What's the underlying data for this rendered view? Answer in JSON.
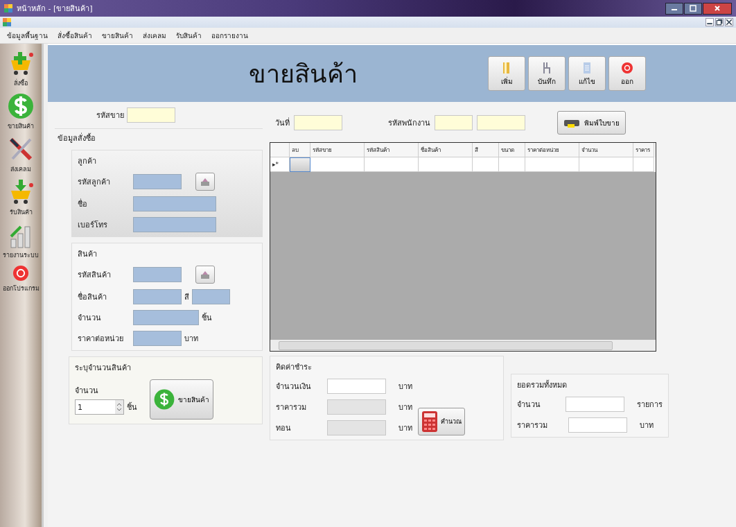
{
  "window": {
    "title": "หน้าหลัก - [ขายสินค้า]"
  },
  "menu": [
    "ข้อมูลพื้นฐาน",
    "สั่งซื้อสินค้า",
    "ขายสินค้า",
    "ส่งเคลม",
    "รับสินค้า",
    "ออกรายงาน"
  ],
  "sidebar": {
    "items": [
      {
        "label": "สั่งซื้อ",
        "kind": "cart-plus"
      },
      {
        "label": "ขายสินค้า",
        "kind": "dollar"
      },
      {
        "label": "ส่งเคลม",
        "kind": "tools"
      },
      {
        "label": "รับสินค้า",
        "kind": "cart-in"
      },
      {
        "label": "รายงานระบบ",
        "kind": "chart"
      },
      {
        "label": "ออกโปรแกรม",
        "kind": "power"
      }
    ]
  },
  "header": {
    "title": "ขายสินค้า",
    "buttons": [
      {
        "label": "เพิ่ม",
        "kind": "add"
      },
      {
        "label": "บันทึก",
        "kind": "save"
      },
      {
        "label": "แก้ไข",
        "kind": "edit"
      },
      {
        "label": "ออก",
        "kind": "exit"
      }
    ]
  },
  "sale_id": {
    "label": "รหัสขาย"
  },
  "order_info": {
    "title": "ข้อมูลสั่งซื้อ",
    "customer": {
      "title": "ลูกค้า",
      "id_label": "รหัสลูกค้า",
      "name_label": "ชื่อ",
      "phone_label": "เบอร์โทร"
    },
    "product": {
      "title": "สินค้า",
      "id_label": "รหัสสินค้า",
      "name_label": "ชื่อสินค้า",
      "color_label": "สี",
      "qty_label": "จำนวน",
      "qty_unit": "ชิ้น",
      "price_label": "ราคาต่อหน่วย",
      "price_unit": "บาท"
    }
  },
  "quantity_box": {
    "title": "ระบุจำนวนสินค้า",
    "label": "จำนวน",
    "value": "1",
    "unit": "ชิ้น",
    "button": "ขายสินค้า"
  },
  "date": {
    "label": "วันที่"
  },
  "employee": {
    "label": "รหัสพนักงาน"
  },
  "print_button": "พิมพ์ใบขาย",
  "table": {
    "columns": [
      "ลบ",
      "รหัสขาย",
      "รหัสสินค้า",
      "ชื่อสินค้า",
      "สี",
      "ขนาด",
      "ราคาต่อหน่วย",
      "จำนวน",
      "ราคาร"
    ],
    "row_marker": "▸*"
  },
  "payment": {
    "title": "คิดค่าชำระ",
    "amount_label": "จำนวนเงิน",
    "total_label": "ราคารวม",
    "change_label": "ทอน",
    "amount_unit": "บาท",
    "total_unit": "บาท",
    "change_unit": "บาท",
    "button": "คำนวณ"
  },
  "summary": {
    "title": "ยอดรวมทั้งหมด",
    "count_label": "จำนวน",
    "count_unit": "รายการ",
    "total_label": "ราคารวม",
    "total_unit": "บาท"
  }
}
